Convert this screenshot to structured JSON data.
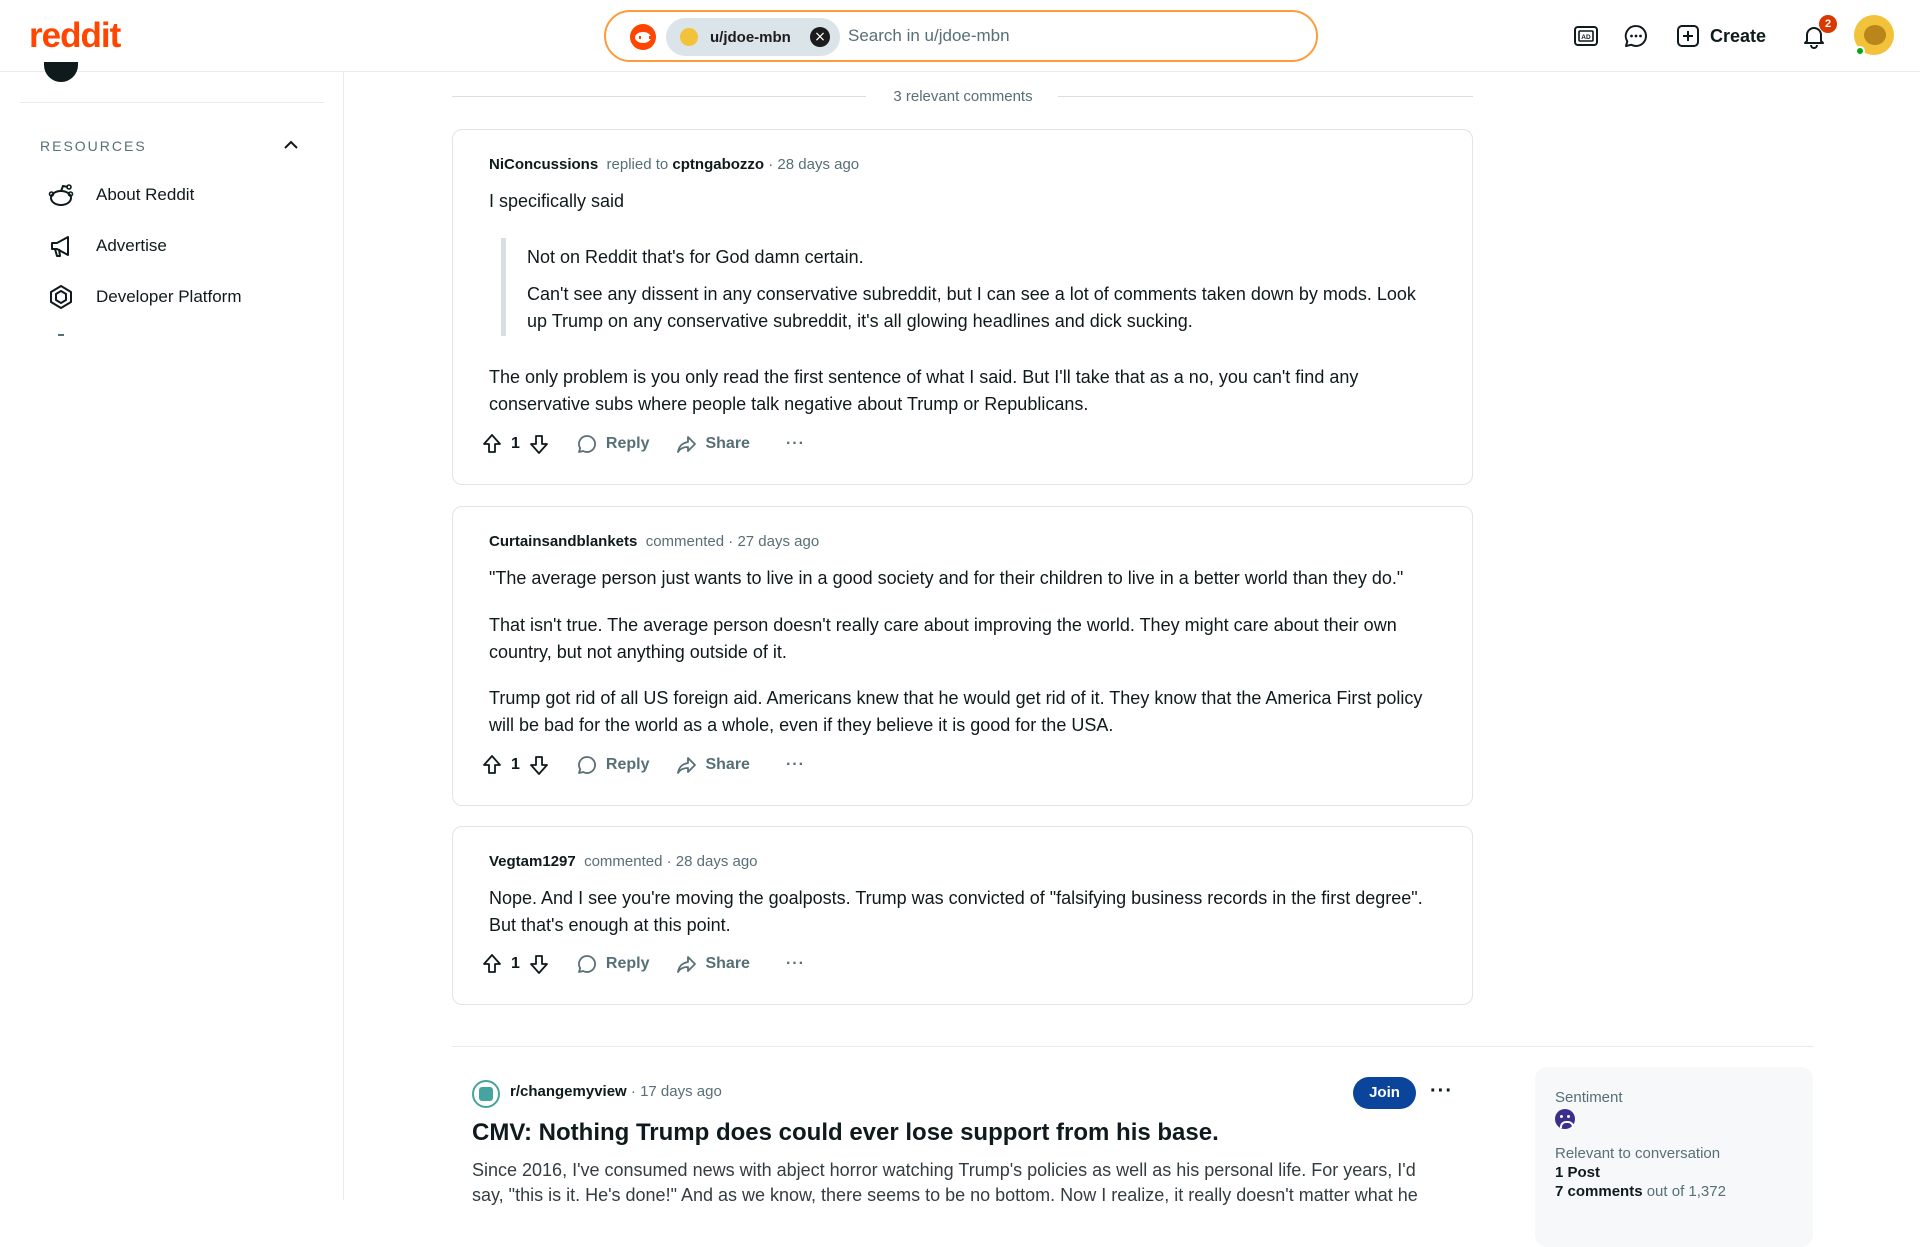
{
  "header": {
    "logo": "reddit",
    "search_chip": "u/jdoe-mbn",
    "search_placeholder": "Search in u/jdoe-mbn",
    "create_label": "Create",
    "notification_count": "2"
  },
  "sidebar": {
    "section_title": "RESOURCES",
    "items": [
      {
        "label": "About Reddit",
        "icon": "reddit-alien-icon"
      },
      {
        "label": "Advertise",
        "icon": "megaphone-icon"
      },
      {
        "label": "Developer Platform",
        "icon": "developer-platform-icon"
      }
    ]
  },
  "main": {
    "relevant_comments": "3 relevant comments",
    "comments": [
      {
        "author": "NiConcussions",
        "action": "replied to",
        "target": "cptngabozzo",
        "time": "28 days ago",
        "intro": "I specifically said",
        "quote": [
          "Not on Reddit that's for God damn certain.",
          "Can't see any dissent in any conservative subreddit, but I can see a lot of comments taken down by mods. Look up Trump on any conservative subreddit, it's all glowing headlines and dick sucking."
        ],
        "body": "The only problem is you only read the first sentence of what I said. But I'll take that as a no, you can't find any conservative subs where people talk negative about Trump or Republicans.",
        "votes": "1"
      },
      {
        "author": "Curtainsandblankets",
        "action": "commented",
        "time": "27 days ago",
        "paragraphs": [
          "\"The average person just wants to live in a good society and for their children to live in a better world than they do.\"",
          "That isn't true. The average person doesn't really care about improving the world. They might care about their own country, but not anything outside of it.",
          "Trump got rid of all US foreign aid. Americans knew that he would get rid of it. They know that the America First policy will be bad for the world as a whole, even if they believe it is good for the USA."
        ],
        "votes": "1"
      },
      {
        "author": "Vegtam1297",
        "action": "commented",
        "time": "28 days ago",
        "paragraphs": [
          "Nope. And I see you're moving the goalposts. Trump was convicted of \"falsifying business records in the first degree\". But that's enough at this point."
        ],
        "votes": "1"
      }
    ],
    "actions": {
      "reply": "Reply",
      "share": "Share",
      "more": "···"
    },
    "post": {
      "subreddit": "r/changemyview",
      "time": "17 days ago",
      "join": "Join",
      "title": "CMV: Nothing Trump does could ever lose support from his base.",
      "body": "Since 2016, I've consumed news with abject horror watching Trump's policies as well as his personal life. For years, I'd say, \"this is it. He's done!\" And as we know, there seems to be no bottom. Now I realize, it really doesn't matter what he"
    },
    "sentiment": {
      "label": "Sentiment",
      "relevant_label": "Relevant to conversation",
      "post_count": "1 Post",
      "comments_bold": "7 comments",
      "comments_rest": "out of 1,372"
    }
  }
}
